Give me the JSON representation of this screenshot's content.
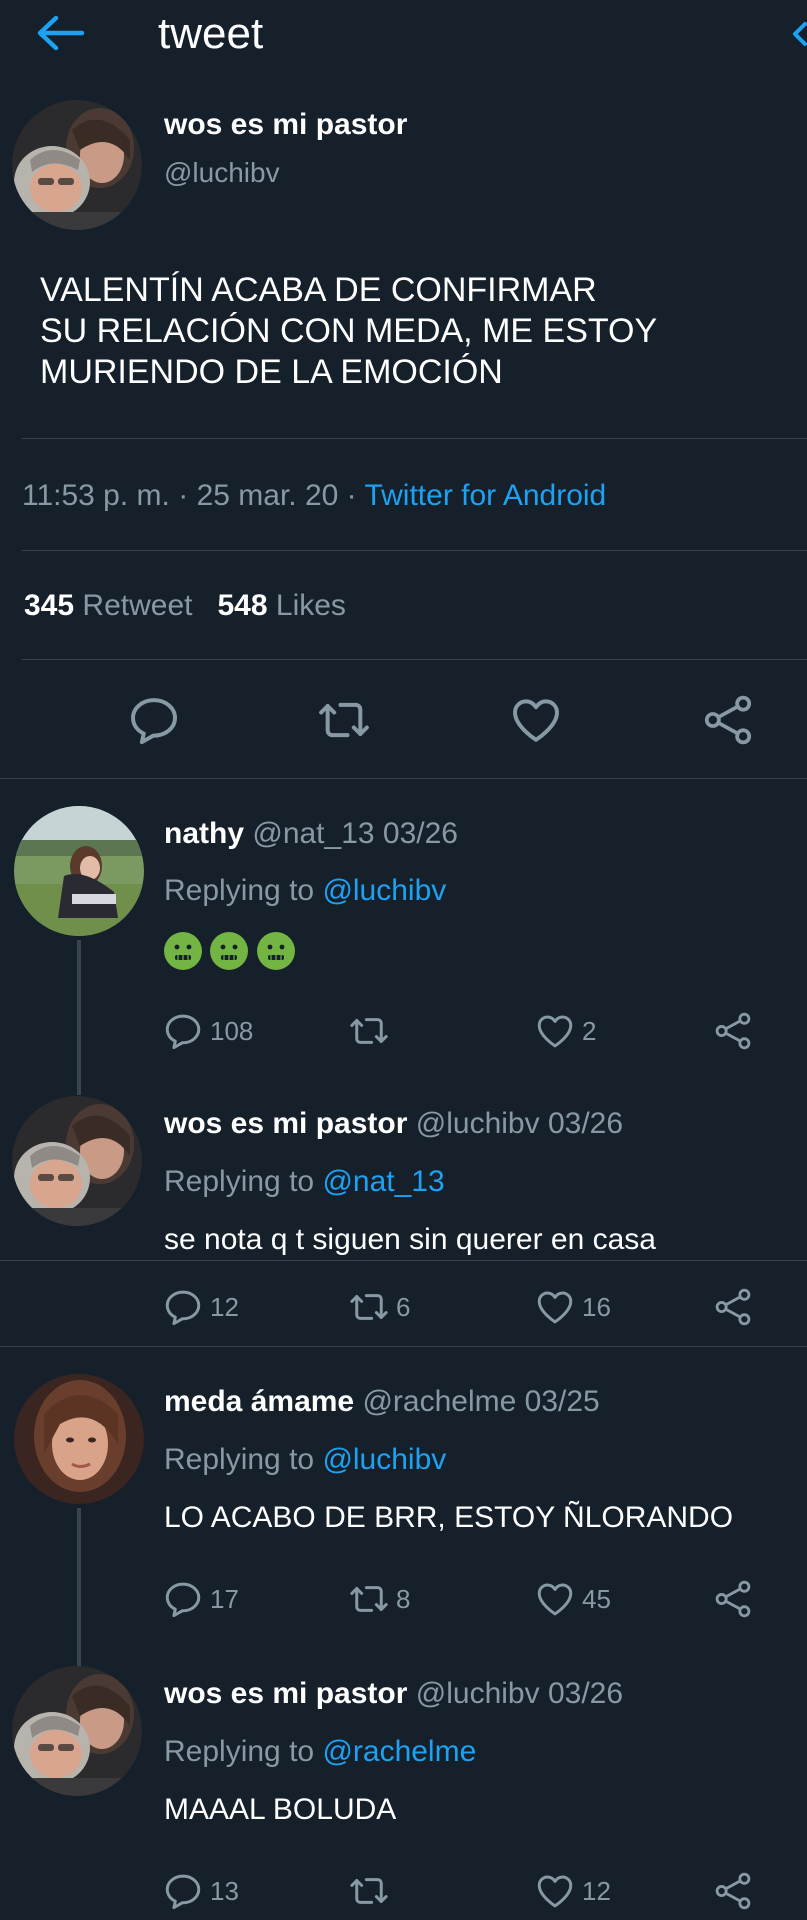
{
  "header": {
    "title": "tweet"
  },
  "colors": {
    "background": "#15202b",
    "muted": "#8899a6",
    "link": "#1da1f2",
    "divider": "#38444d",
    "emoji": "#73b542"
  },
  "tweet": {
    "author_name": "wos es mi pastor",
    "author_handle": "@luchibv",
    "text": "VALENTÍN ACABA DE CONFIRMAR\nSU RELACIÓN CON MEDA, ME ESTOY\nMURIENDO DE LA EMOCIÓN",
    "time": "11:53 p. m.",
    "date": "25 mar. 20",
    "source": "Twitter for Android",
    "separator": "·",
    "retweets": "345",
    "retweets_label": "Retweet",
    "likes": "548",
    "likes_label": "Likes",
    "icons": [
      "reply-icon",
      "retweet-icon",
      "like-icon",
      "share-icon"
    ]
  },
  "replies": [
    {
      "name": "nathy",
      "handle": "@nat_13",
      "date": "03/26",
      "replying_label": "Replying to",
      "replying_to": "@luchibv",
      "text": "",
      "emojis": 3,
      "reply_count": "108",
      "retweet_count": "",
      "like_count": "2"
    },
    {
      "name": "wos es mi pastor",
      "handle": "@luchibv",
      "date": "03/26",
      "replying_label": "Replying to",
      "replying_to": "@nat_13",
      "text": "se nota q t siguen sin querer en casa",
      "reply_count": "12",
      "retweet_count": "6",
      "like_count": "16"
    },
    {
      "name": "meda ámame",
      "handle": "@rachelme",
      "date": "03/25",
      "replying_label": "Replying to",
      "replying_to": "@luchibv",
      "text": "LO ACABO DE BRR, ESTOY ÑLORANDO",
      "reply_count": "17",
      "retweet_count": "8",
      "like_count": "45"
    },
    {
      "name": "wos es mi pastor",
      "handle": "@luchibv",
      "date": "03/26",
      "replying_label": "Replying to",
      "replying_to": "@rachelme",
      "text": "MAAAL BOLUDA",
      "reply_count": "13",
      "retweet_count": "",
      "like_count": "12"
    }
  ]
}
